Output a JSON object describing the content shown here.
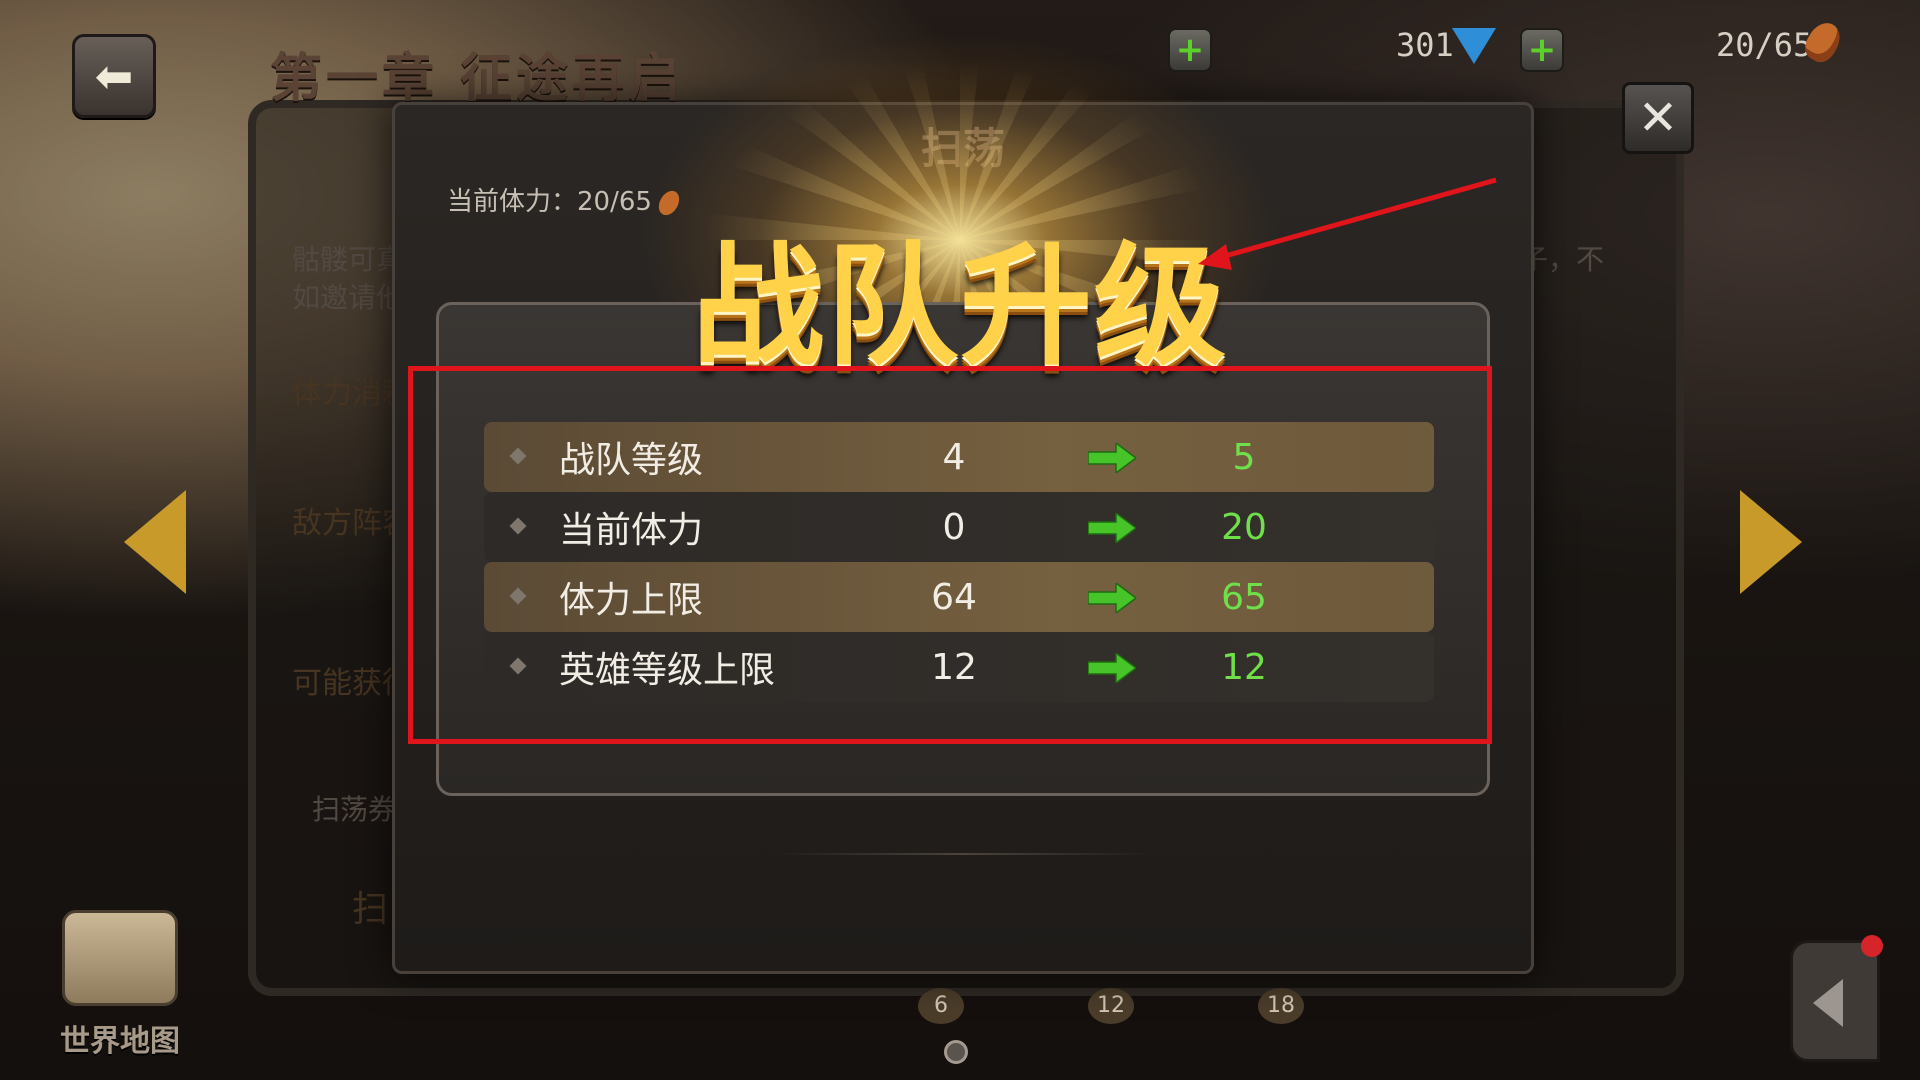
{
  "header": {
    "chapter_title": "第一章 征途再启",
    "gems": "301",
    "stamina": "20/65"
  },
  "world_map": {
    "label": "世界地图"
  },
  "stage_panel": {
    "desc_line1": "骷髅可真",
    "desc_line2": "如邀请他",
    "desc_right": "子，不",
    "stamina_cost_label": "体力消耗",
    "enemy_label": "敌方阵容",
    "rewards_label": "可能获得",
    "sweep_ticket_label": "扫荡券",
    "sweep_button_label": "扫",
    "progress_marks": [
      "6",
      "12",
      "18"
    ]
  },
  "sweep_dialog": {
    "title": "扫荡",
    "current_stamina": "当前体力：20/65"
  },
  "levelup": {
    "title": "战队升级",
    "rows": [
      {
        "name": "战队等级",
        "old": "4",
        "new": "5"
      },
      {
        "name": "当前体力",
        "old": "0",
        "new": "20"
      },
      {
        "name": "体力上限",
        "old": "64",
        "new": "65"
      },
      {
        "name": "英雄等级上限",
        "old": "12",
        "new": "12"
      }
    ]
  },
  "colors": {
    "annotation": "#e0141b",
    "new_value": "#6fe04a",
    "title_gold": "#ffd24a"
  },
  "icons": [
    "back-arrow-icon",
    "plus-icon",
    "gem-icon",
    "drumstick-icon",
    "close-icon",
    "map-icon",
    "right-arrow-icon"
  ]
}
